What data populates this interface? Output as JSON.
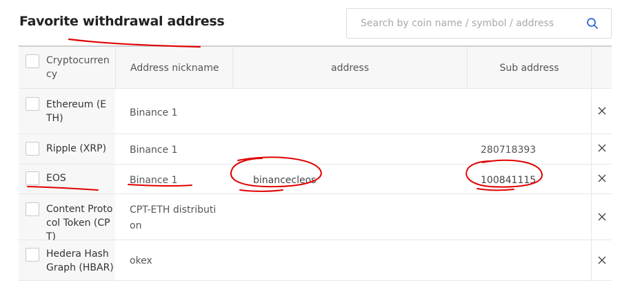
{
  "page": {
    "title": "Favorite withdrawal address"
  },
  "search": {
    "placeholder": "Search by coin name / symbol / address"
  },
  "table": {
    "headers": {
      "crypto": "Cryptocurrency",
      "nickname": "Address nickname",
      "address": "address",
      "sub_address": "Sub address"
    },
    "rows": [
      {
        "crypto": "Ethereum (ETH)",
        "nickname": "Binance 1",
        "address": "",
        "sub_address": ""
      },
      {
        "crypto": "Ripple (XRP)",
        "nickname": "Binance 1",
        "address": "",
        "sub_address": "280718393"
      },
      {
        "crypto": "EOS",
        "nickname": "Binance 1",
        "address": "binancecleos",
        "sub_address": "100841115"
      },
      {
        "crypto": "Content Protocol Token (CPT)",
        "nickname": "CPT-ETH distribution",
        "address": "",
        "sub_address": ""
      },
      {
        "crypto": "Hedera Hash Graph (HBAR)",
        "nickname": "okex",
        "address": "",
        "sub_address": ""
      }
    ]
  },
  "colors": {
    "annotation": "#e00000",
    "accent": "#2a66d6"
  },
  "icons": {
    "search": "search-icon",
    "delete": "close-icon"
  }
}
